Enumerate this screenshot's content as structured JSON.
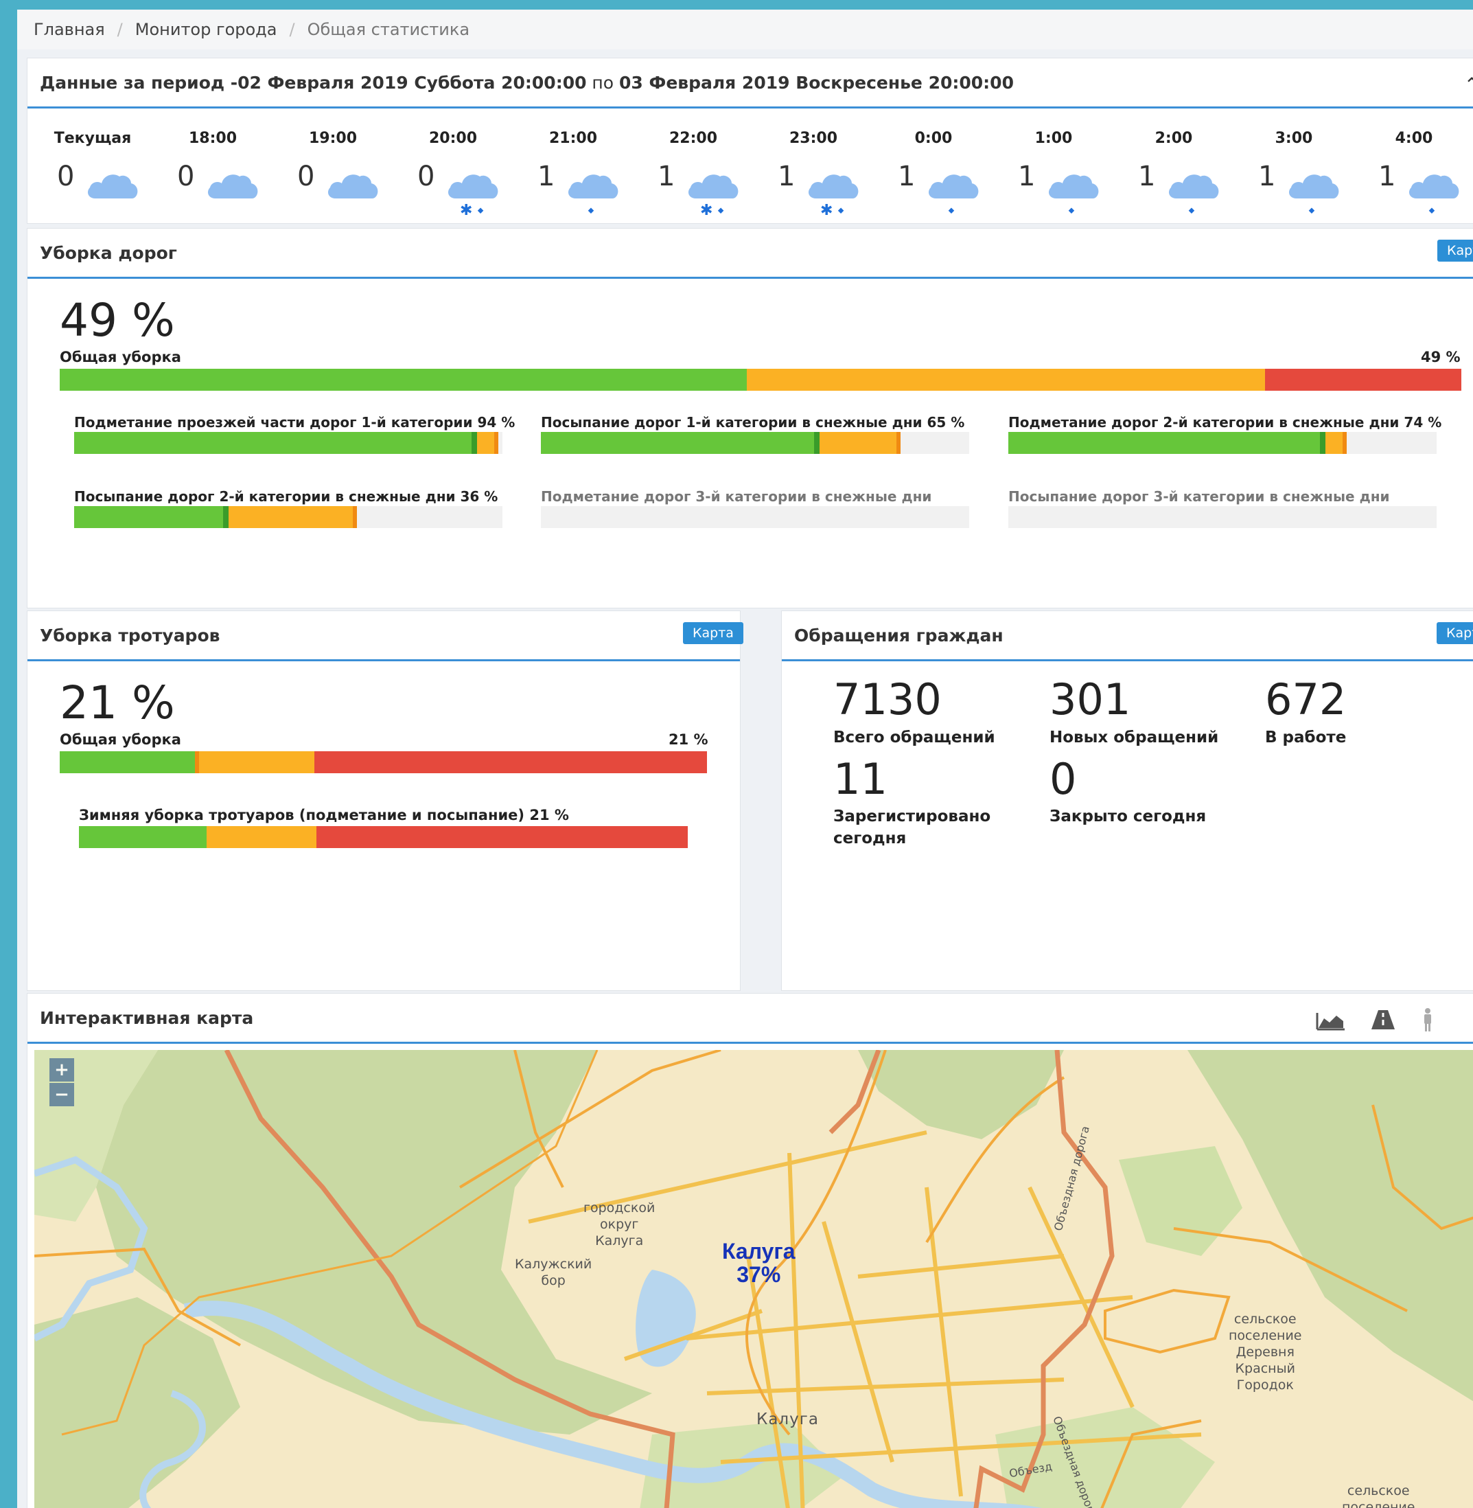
{
  "breadcrumb": {
    "home": "Главная",
    "monitor": "Монитор города",
    "current": "Общая статистика"
  },
  "period": {
    "prefix": "Данные за период - ",
    "from": "02 Февраля 2019 Суббота 20:00:00",
    "mid": " по ",
    "to": "03 Февраля 2019 Воскресенье 20:00:00"
  },
  "weather": [
    {
      "time": "Текущая",
      "value": "0",
      "precip": "none"
    },
    {
      "time": "18:00",
      "value": "0",
      "precip": "none"
    },
    {
      "time": "19:00",
      "value": "0",
      "precip": "none"
    },
    {
      "time": "20:00",
      "value": "0",
      "precip": "snow-rain"
    },
    {
      "time": "21:00",
      "value": "1",
      "precip": "rain"
    },
    {
      "time": "22:00",
      "value": "1",
      "precip": "snow-rain"
    },
    {
      "time": "23:00",
      "value": "1",
      "precip": "snow-rain"
    },
    {
      "time": "0:00",
      "value": "1",
      "precip": "rain"
    },
    {
      "time": "1:00",
      "value": "1",
      "precip": "rain"
    },
    {
      "time": "2:00",
      "value": "1",
      "precip": "rain"
    },
    {
      "time": "3:00",
      "value": "1",
      "precip": "rain"
    },
    {
      "time": "4:00",
      "value": "1",
      "precip": "rain"
    }
  ],
  "roads": {
    "title": "Уборка дорог",
    "map_btn": "Карта",
    "total_pct": "49 %",
    "total_label": "Общая уборка",
    "total_right": "49 %",
    "total_bar": {
      "green": 49,
      "yellow": 37,
      "red": 14
    },
    "items": [
      {
        "label": "Подметание проезжей части дорог 1-й категории",
        "pct": "94 %",
        "green": 94,
        "yellow": 4
      },
      {
        "label": "Посыпание дорог 1-й категории в снежные дни",
        "pct": "65 %",
        "green": 65,
        "yellow": 18
      },
      {
        "label": "Подметание дорог 2-й категории в снежные дни",
        "pct": "74 %",
        "green": 74,
        "yellow": 4
      },
      {
        "label": "Посыпание дорог 2-й категории в снежные дни",
        "pct": "36 %",
        "green": 36,
        "yellow": 29
      },
      {
        "label": "Подметание дорог 3-й категории в снежные дни",
        "pct": "",
        "green": 0,
        "yellow": 0
      },
      {
        "label": "Посыпание дорог 3-й категории в снежные дни",
        "pct": "",
        "green": 0,
        "yellow": 0
      }
    ]
  },
  "sidewalks": {
    "title": "Уборка тротуаров",
    "map_btn": "Карта",
    "total_pct": "21 %",
    "total_label": "Общая уборка",
    "total_right": "21 %",
    "total_bar": {
      "green": 21,
      "yellow": 18,
      "red": 61
    },
    "item": {
      "label": "Зимняя уборка тротуаров (подметание и посыпание)",
      "pct": "21 %",
      "green": 21,
      "yellow": 18,
      "red": 61
    }
  },
  "appeals": {
    "title": "Обращения граждан",
    "map_btn": "Карта",
    "total": "7130",
    "total_label": "Всего обращений",
    "new": "301",
    "new_label": "Новых обращений",
    "in_work": "672",
    "in_work_label": "В работе",
    "registered": "11",
    "registered_label_1": "Зарегистировано",
    "registered_label_2": "сегодня",
    "closed": "0",
    "closed_label": "Закрыто сегодня"
  },
  "map": {
    "title": "Интерактивная карта",
    "zoom_in": "+",
    "zoom_out": "−",
    "city_label": "Калуга",
    "city_pct": "37%",
    "labels": {
      "district_1": "городской",
      "district_2": "округ",
      "district_3": "Калуга",
      "bor_1": "Калужский",
      "bor_2": "бор",
      "city_small": "Калуга",
      "rural_1": "сельское",
      "rural_2": "поселение",
      "rural_3": "Деревня",
      "rural_4": "Красный",
      "rural_5": "Городок",
      "rural_b1": "сельское",
      "rural_b2": "поселение",
      "road_1": "Объездная дорога",
      "road_2": "Объездная дорога",
      "road_3": "Объезд"
    },
    "colors": {
      "land": "#f5e9c6",
      "forest": "#c9d9a3",
      "water": "#b7d6ee",
      "road": "#f2a93b",
      "major_road": "#e08a5a"
    }
  },
  "colors": {
    "green": "#66c63a",
    "yellow": "#fbb124",
    "red": "#e5493d",
    "accent": "#2c8fd6"
  }
}
